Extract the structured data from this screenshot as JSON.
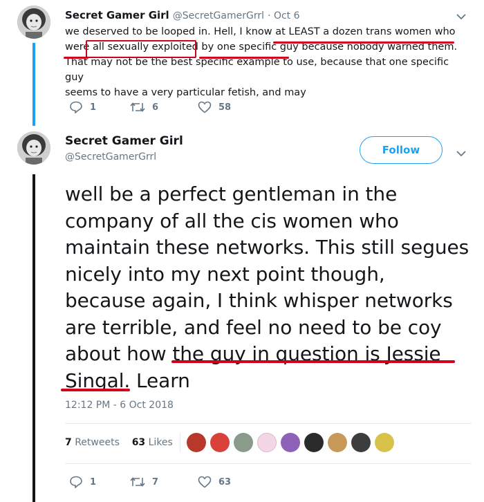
{
  "reply": {
    "name": "Secret Gamer Girl",
    "handle": "@SecretGamerGrrl",
    "date": "· Oct 6",
    "lines": [
      "we deserved to be looped in. Hell, I know at LEAST a dozen trans women who",
      "were all sexually exploited by one specific guy because nobody warned them.",
      "That may not be the best specific example to use, because that one specific guy",
      "seems to have a very particular fetish, and may"
    ],
    "reply_count": "1",
    "retweet_count": "6",
    "like_count": "58"
  },
  "main": {
    "name": "Secret Gamer Girl",
    "handle": "@SecretGamerGrrl",
    "follow_label": "Follow",
    "lines": [
      "well be a perfect gentleman in the",
      "company of all the cis women who",
      "maintain these networks. This still segues",
      "nicely into my next point though,",
      "because again, I think whisper networks",
      "are terrible, and feel no need to be coy",
      "about how the guy in question is Jessie",
      "Singal. Learn"
    ],
    "timestamp": "12:12 PM - 6 Oct 2018",
    "retweets_num": "7",
    "retweets_label": "Retweets",
    "likes_num": "63",
    "likes_label": "Likes",
    "reply_count": "1",
    "retweet_count": "7",
    "like_count": "63"
  },
  "colors": {
    "accent": "#1da1f2",
    "annotation": "#d0021b",
    "muted": "#657786"
  }
}
